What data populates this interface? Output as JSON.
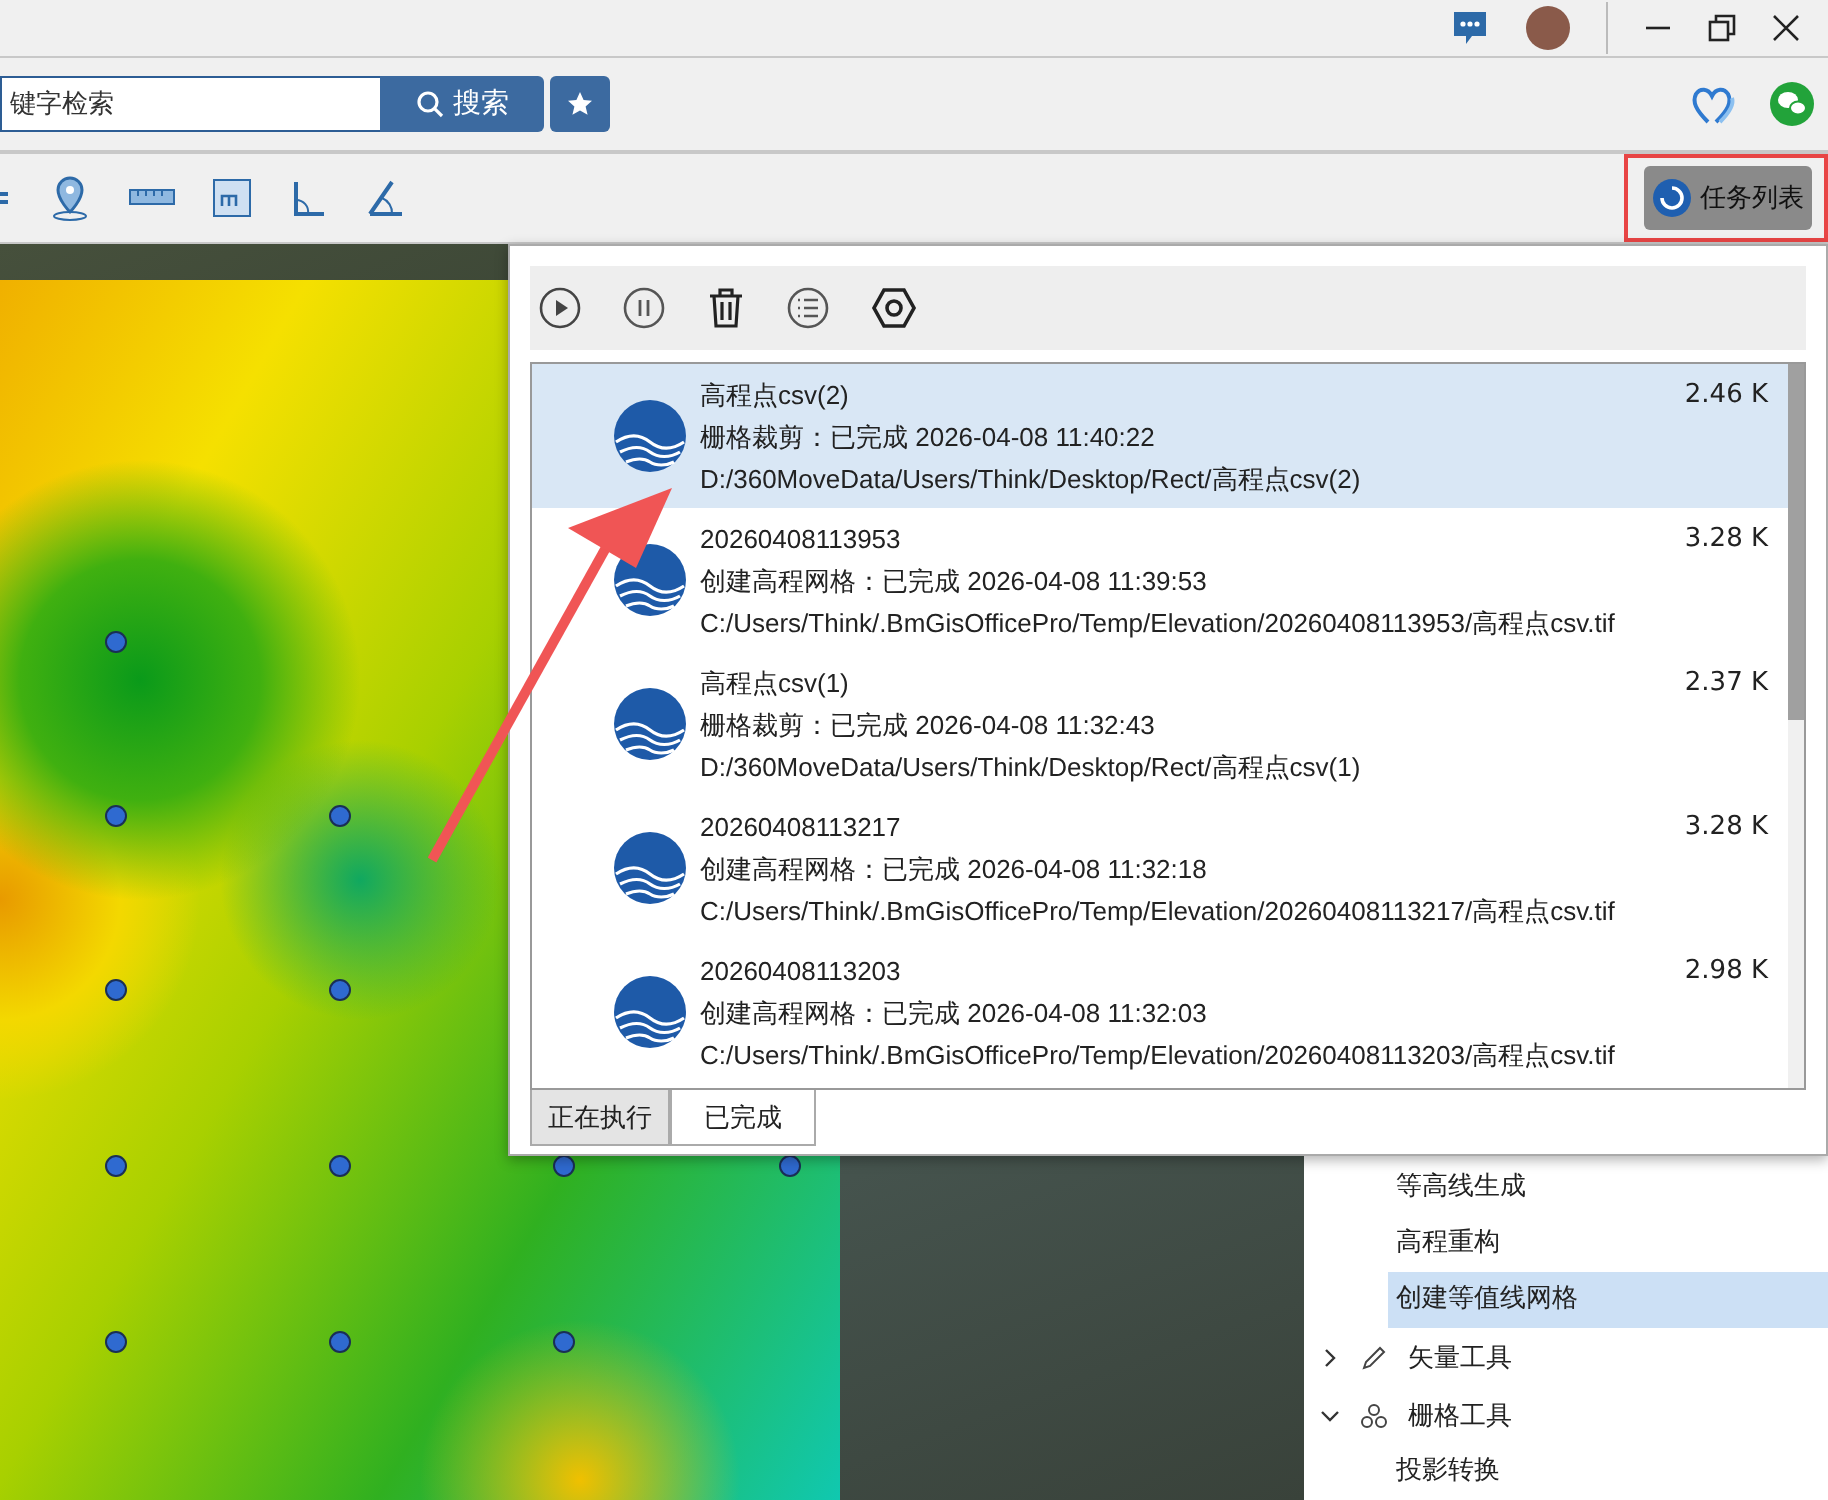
{
  "search": {
    "placeholder": "键字检索",
    "button": "搜索"
  },
  "task_button": {
    "label": "任务列表"
  },
  "task_panel": {
    "tasks": [
      {
        "name": "高程点csv(2)",
        "status": "栅格裁剪：已完成 2026-04-08 11:40:22",
        "path": "D:/360MoveData/Users/Think/Desktop/Rect/高程点csv(2)",
        "size": "2.46 K",
        "selected": true
      },
      {
        "name": "20260408113953",
        "status": "创建高程网格：已完成 2026-04-08 11:39:53",
        "path": "C:/Users/Think/.BmGisOfficePro/Temp/Elevation/20260408113953/高程点csv.tif",
        "size": "3.28 K",
        "selected": false
      },
      {
        "name": "高程点csv(1)",
        "status": "栅格裁剪：已完成 2026-04-08 11:32:43",
        "path": "D:/360MoveData/Users/Think/Desktop/Rect/高程点csv(1)",
        "size": "2.37 K",
        "selected": false
      },
      {
        "name": "20260408113217",
        "status": "创建高程网格：已完成 2026-04-08 11:32:18",
        "path": "C:/Users/Think/.BmGisOfficePro/Temp/Elevation/20260408113217/高程点csv.tif",
        "size": "3.28 K",
        "selected": false
      },
      {
        "name": "20260408113203",
        "status": "创建高程网格：已完成 2026-04-08 11:32:03",
        "path": "C:/Users/Think/.BmGisOfficePro/Temp/Elevation/20260408113203/高程点csv.tif",
        "size": "2.98 K",
        "selected": false
      }
    ],
    "tabs": [
      {
        "label": "正在执行",
        "selected": false
      },
      {
        "label": "已完成",
        "selected": true
      }
    ]
  },
  "tool_tree": [
    {
      "label": "等高线生成",
      "selected": false
    },
    {
      "label": "高程重构",
      "selected": false
    },
    {
      "label": "创建等值线网格",
      "selected": true
    },
    {
      "label": "矢量工具",
      "kind": "vector",
      "expanded": false
    },
    {
      "label": "栅格工具",
      "kind": "raster",
      "expanded": true,
      "children": [
        {
          "label": "投影转换",
          "selected": false
        }
      ]
    }
  ]
}
